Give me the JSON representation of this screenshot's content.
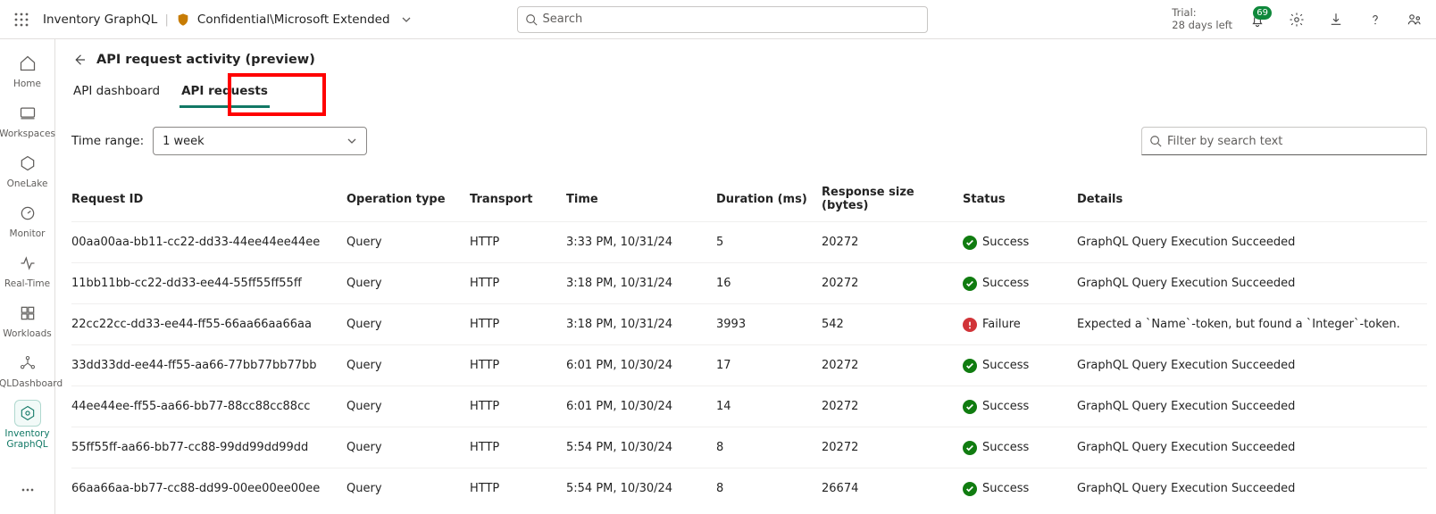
{
  "topbar": {
    "breadcrumb_item": "Inventory GraphQL",
    "sensitivity": "Confidential\\Microsoft Extended",
    "search_placeholder": "Search",
    "trial_line1": "Trial:",
    "trial_line2": "28 days left",
    "notifications_badge": "69"
  },
  "sidebar": {
    "items": [
      {
        "label": "Home"
      },
      {
        "label": "Workspaces"
      },
      {
        "label": "OneLake"
      },
      {
        "label": "Monitor"
      },
      {
        "label": "Real-Time"
      },
      {
        "label": "Workloads"
      },
      {
        "label": "GQLDashboard"
      },
      {
        "label": "Inventory GraphQL"
      }
    ]
  },
  "page": {
    "title": "API request activity (preview)",
    "tabs": [
      {
        "label": "API dashboard"
      },
      {
        "label": "API requests"
      }
    ],
    "active_tab_index": 1,
    "time_range_label": "Time range:",
    "time_range_value": "1 week",
    "filter_placeholder": "Filter by search text"
  },
  "table": {
    "columns": [
      "Request ID",
      "Operation type",
      "Transport",
      "Time",
      "Duration (ms)",
      "Response size (bytes)",
      "Status",
      "Details"
    ],
    "rows": [
      {
        "id": "00aa00aa-bb11-cc22-dd33-44ee44ee44ee",
        "op": "Query",
        "transport": "HTTP",
        "time": "3:33 PM, 10/31/24",
        "duration": "5",
        "size": "20272",
        "status": "Success",
        "status_kind": "success",
        "details": "GraphQL Query Execution Succeeded"
      },
      {
        "id": "11bb11bb-cc22-dd33-ee44-55ff55ff55ff",
        "op": "Query",
        "transport": "HTTP",
        "time": "3:18 PM, 10/31/24",
        "duration": "16",
        "size": "20272",
        "status": "Success",
        "status_kind": "success",
        "details": "GraphQL Query Execution Succeeded"
      },
      {
        "id": "22cc22cc-dd33-ee44-ff55-66aa66aa66aa",
        "op": "Query",
        "transport": "HTTP",
        "time": "3:18 PM, 10/31/24",
        "duration": "3993",
        "size": "542",
        "status": "Failure",
        "status_kind": "failure",
        "details": "Expected a `Name`-token, but found a `Integer`-token."
      },
      {
        "id": "33dd33dd-ee44-ff55-aa66-77bb77bb77bb",
        "op": "Query",
        "transport": "HTTP",
        "time": "6:01 PM, 10/30/24",
        "duration": "17",
        "size": "20272",
        "status": "Success",
        "status_kind": "success",
        "details": "GraphQL Query Execution Succeeded"
      },
      {
        "id": "44ee44ee-ff55-aa66-bb77-88cc88cc88cc",
        "op": "Query",
        "transport": "HTTP",
        "time": "6:01 PM, 10/30/24",
        "duration": "14",
        "size": "20272",
        "status": "Success",
        "status_kind": "success",
        "details": "GraphQL Query Execution Succeeded"
      },
      {
        "id": "55ff55ff-aa66-bb77-cc88-99dd99dd99dd",
        "op": "Query",
        "transport": "HTTP",
        "time": "5:54 PM, 10/30/24",
        "duration": "8",
        "size": "20272",
        "status": "Success",
        "status_kind": "success",
        "details": "GraphQL Query Execution Succeeded"
      },
      {
        "id": "66aa66aa-bb77-cc88-dd99-00ee00ee00ee",
        "op": "Query",
        "transport": "HTTP",
        "time": "5:54 PM, 10/30/24",
        "duration": "8",
        "size": "26674",
        "status": "Success",
        "status_kind": "success",
        "details": "GraphQL Query Execution Succeeded"
      }
    ]
  }
}
